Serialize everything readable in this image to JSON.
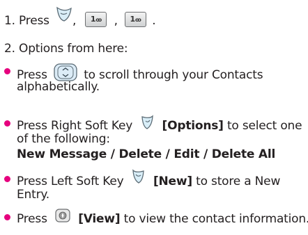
{
  "step1": {
    "prefix": "1. Press",
    "comma": ",",
    "comma2": ",",
    "period": ".",
    "key_labels": [
      "1",
      "1"
    ]
  },
  "step2": {
    "text": "2. Options from here:"
  },
  "bullets": [
    {
      "pre": "Press",
      "post": "to scroll through your Contacts",
      "post2": "alphabetically."
    },
    {
      "pre": "Press Right Soft Key",
      "bold": "[Options]",
      "post": "to select one",
      "line2": "of the following:",
      "line3": "New Message / Delete / Edit / Delete All"
    },
    {
      "pre": "Press Left Soft Key",
      "bold": "[New]",
      "post": "to store a New",
      "line2": "Entry."
    },
    {
      "pre": "Press",
      "bold": "[View]",
      "post": "to view the contact information."
    }
  ],
  "colors": {
    "bullet": "#e6007e",
    "text": "#231f20"
  },
  "icons": [
    "left-soft-key-icon",
    "number-1-key-icon",
    "navigation-key-icon",
    "right-soft-key-icon",
    "ok-key-icon"
  ]
}
